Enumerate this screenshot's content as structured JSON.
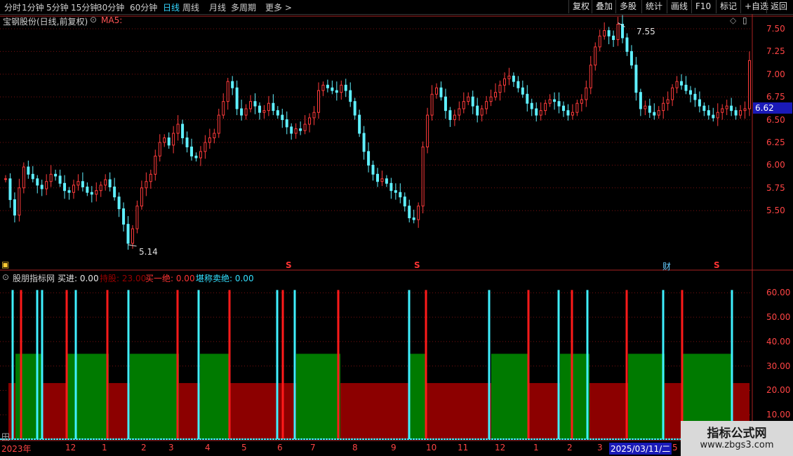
{
  "toolbar": {
    "left": [
      "分时",
      "1分钟",
      "5分钟",
      "15分钟",
      "30分钟",
      "60分钟",
      "日线",
      "周线",
      "月线",
      "多周期",
      "更多 >"
    ],
    "active": "日线",
    "right": [
      "复权",
      "叠加",
      "多股",
      "统计",
      "画线",
      "F10",
      "标记",
      "+自选",
      "返回"
    ]
  },
  "main_chart": {
    "title": "宝钢股份(日线,前复权)",
    "ma_label": "MA5:",
    "high_label": "7.55",
    "low_label": "5.14",
    "current_price": "6.62",
    "y_ticks": [
      "7.50",
      "7.25",
      "7.00",
      "6.75",
      "6.50",
      "6.25",
      "6.00",
      "5.75",
      "5.50"
    ],
    "event_markers": [
      "S",
      "S",
      "财",
      "S"
    ]
  },
  "indicator": {
    "name": "股朋指标网",
    "buy_label": "买进: 0.00",
    "hold_label": "持股: 23.00",
    "buy_top_label": "买一绝: 0.00",
    "sell_label": "堪称卖绝: 0.00",
    "y_ticks": [
      "60.00",
      "50.00",
      "40.00",
      "30.00",
      "20.00",
      "10.00"
    ]
  },
  "x_axis": {
    "labels": [
      "2023年",
      "12",
      "1",
      "2",
      "3",
      "4",
      "5",
      "6",
      "7",
      "8",
      "9",
      "10",
      "11",
      "12",
      "1",
      "2",
      "3",
      "2025/03/11/二",
      "5"
    ]
  },
  "watermark": {
    "line1": "指标公式网",
    "line2": "www.zbgs3.com"
  },
  "chart_data": [
    {
      "type": "line",
      "series": [
        {
          "values": [
            5.85,
            5.62,
            5.45,
            5.75,
            5.98,
            5.9,
            5.85,
            5.78,
            5.74,
            5.82,
            5.9,
            5.88,
            5.8,
            5.72,
            5.7,
            5.78,
            5.82,
            5.76,
            5.7,
            5.68,
            5.72,
            5.78,
            5.84,
            5.76,
            5.65,
            5.52,
            5.35,
            5.14,
            5.3,
            5.55,
            5.75,
            5.82,
            5.9,
            6.1,
            6.25,
            6.3,
            6.22,
            6.35,
            6.45,
            6.3,
            6.2,
            6.1,
            6.08,
            6.15,
            6.25,
            6.3,
            6.35,
            6.55,
            6.7,
            6.92,
            6.85,
            6.62,
            6.55,
            6.62,
            6.7,
            6.65,
            6.58,
            6.6,
            6.68,
            6.6,
            6.55,
            6.5,
            6.42,
            6.35,
            6.4,
            6.38,
            6.45,
            6.52,
            6.58,
            6.82,
            6.88,
            6.85,
            6.82,
            6.8,
            6.88,
            6.82,
            6.7,
            6.55,
            6.35,
            6.15,
            6.0,
            5.9,
            5.82,
            5.85,
            5.8,
            5.72,
            5.7,
            5.65,
            5.55,
            5.42,
            5.4,
            5.55,
            6.2,
            6.55,
            6.78,
            6.85,
            6.75,
            6.6,
            6.5,
            6.55,
            6.62,
            6.7,
            6.75,
            6.65,
            6.55,
            6.62,
            6.7,
            6.75,
            6.8,
            6.88,
            6.95,
            6.98,
            6.92,
            6.85,
            6.78,
            6.68,
            6.62,
            6.55,
            6.6,
            6.68,
            6.72,
            6.7,
            6.65,
            6.6,
            6.55,
            6.58,
            6.68,
            6.72,
            6.85,
            7.1,
            7.3,
            7.42,
            7.48,
            7.42,
            7.38,
            7.55,
            7.4,
            7.25,
            7.1,
            6.8,
            6.62,
            6.65,
            6.58,
            6.55,
            6.6,
            6.68,
            6.72,
            6.85,
            6.92,
            6.88,
            6.82,
            6.78,
            6.72,
            6.65,
            6.6,
            6.55,
            6.52,
            6.58,
            6.62,
            6.65,
            6.6,
            6.55,
            6.6,
            6.62,
            7.15
          ]
        }
      ],
      "ylim": [
        5.0,
        7.6
      ],
      "y_ticks": [
        7.5,
        7.25,
        7.0,
        6.75,
        6.5,
        6.25,
        6.0,
        5.75,
        5.5
      ],
      "high": 7.55,
      "low": 5.14
    },
    {
      "type": "area",
      "ylim": [
        0,
        65
      ],
      "y_ticks": [
        60,
        50,
        40,
        30,
        20,
        10
      ],
      "hold_level": 23,
      "green_level": 35,
      "band_breaks": [
        12,
        22,
        60,
        95,
        155,
        185,
        255,
        285,
        327,
        422,
        485,
        583,
        608,
        700,
        752,
        798,
        840,
        895,
        947,
        973,
        1043,
        1068
      ],
      "band_colors": [
        "red",
        "green",
        "red",
        "green",
        "red",
        "green",
        "red",
        "green",
        "red",
        "green",
        "red",
        "green",
        "red",
        "green",
        "red",
        "green",
        "red",
        "green",
        "red",
        "green",
        "red"
      ],
      "cyan_spikes": [
        18,
        53,
        60,
        108,
        183,
        283,
        395,
        420,
        583,
        697,
        796,
        837,
        945,
        1043
      ],
      "red_spikes": [
        30,
        95,
        153,
        253,
        327,
        403,
        482,
        607,
        753,
        815,
        893,
        972
      ]
    }
  ]
}
